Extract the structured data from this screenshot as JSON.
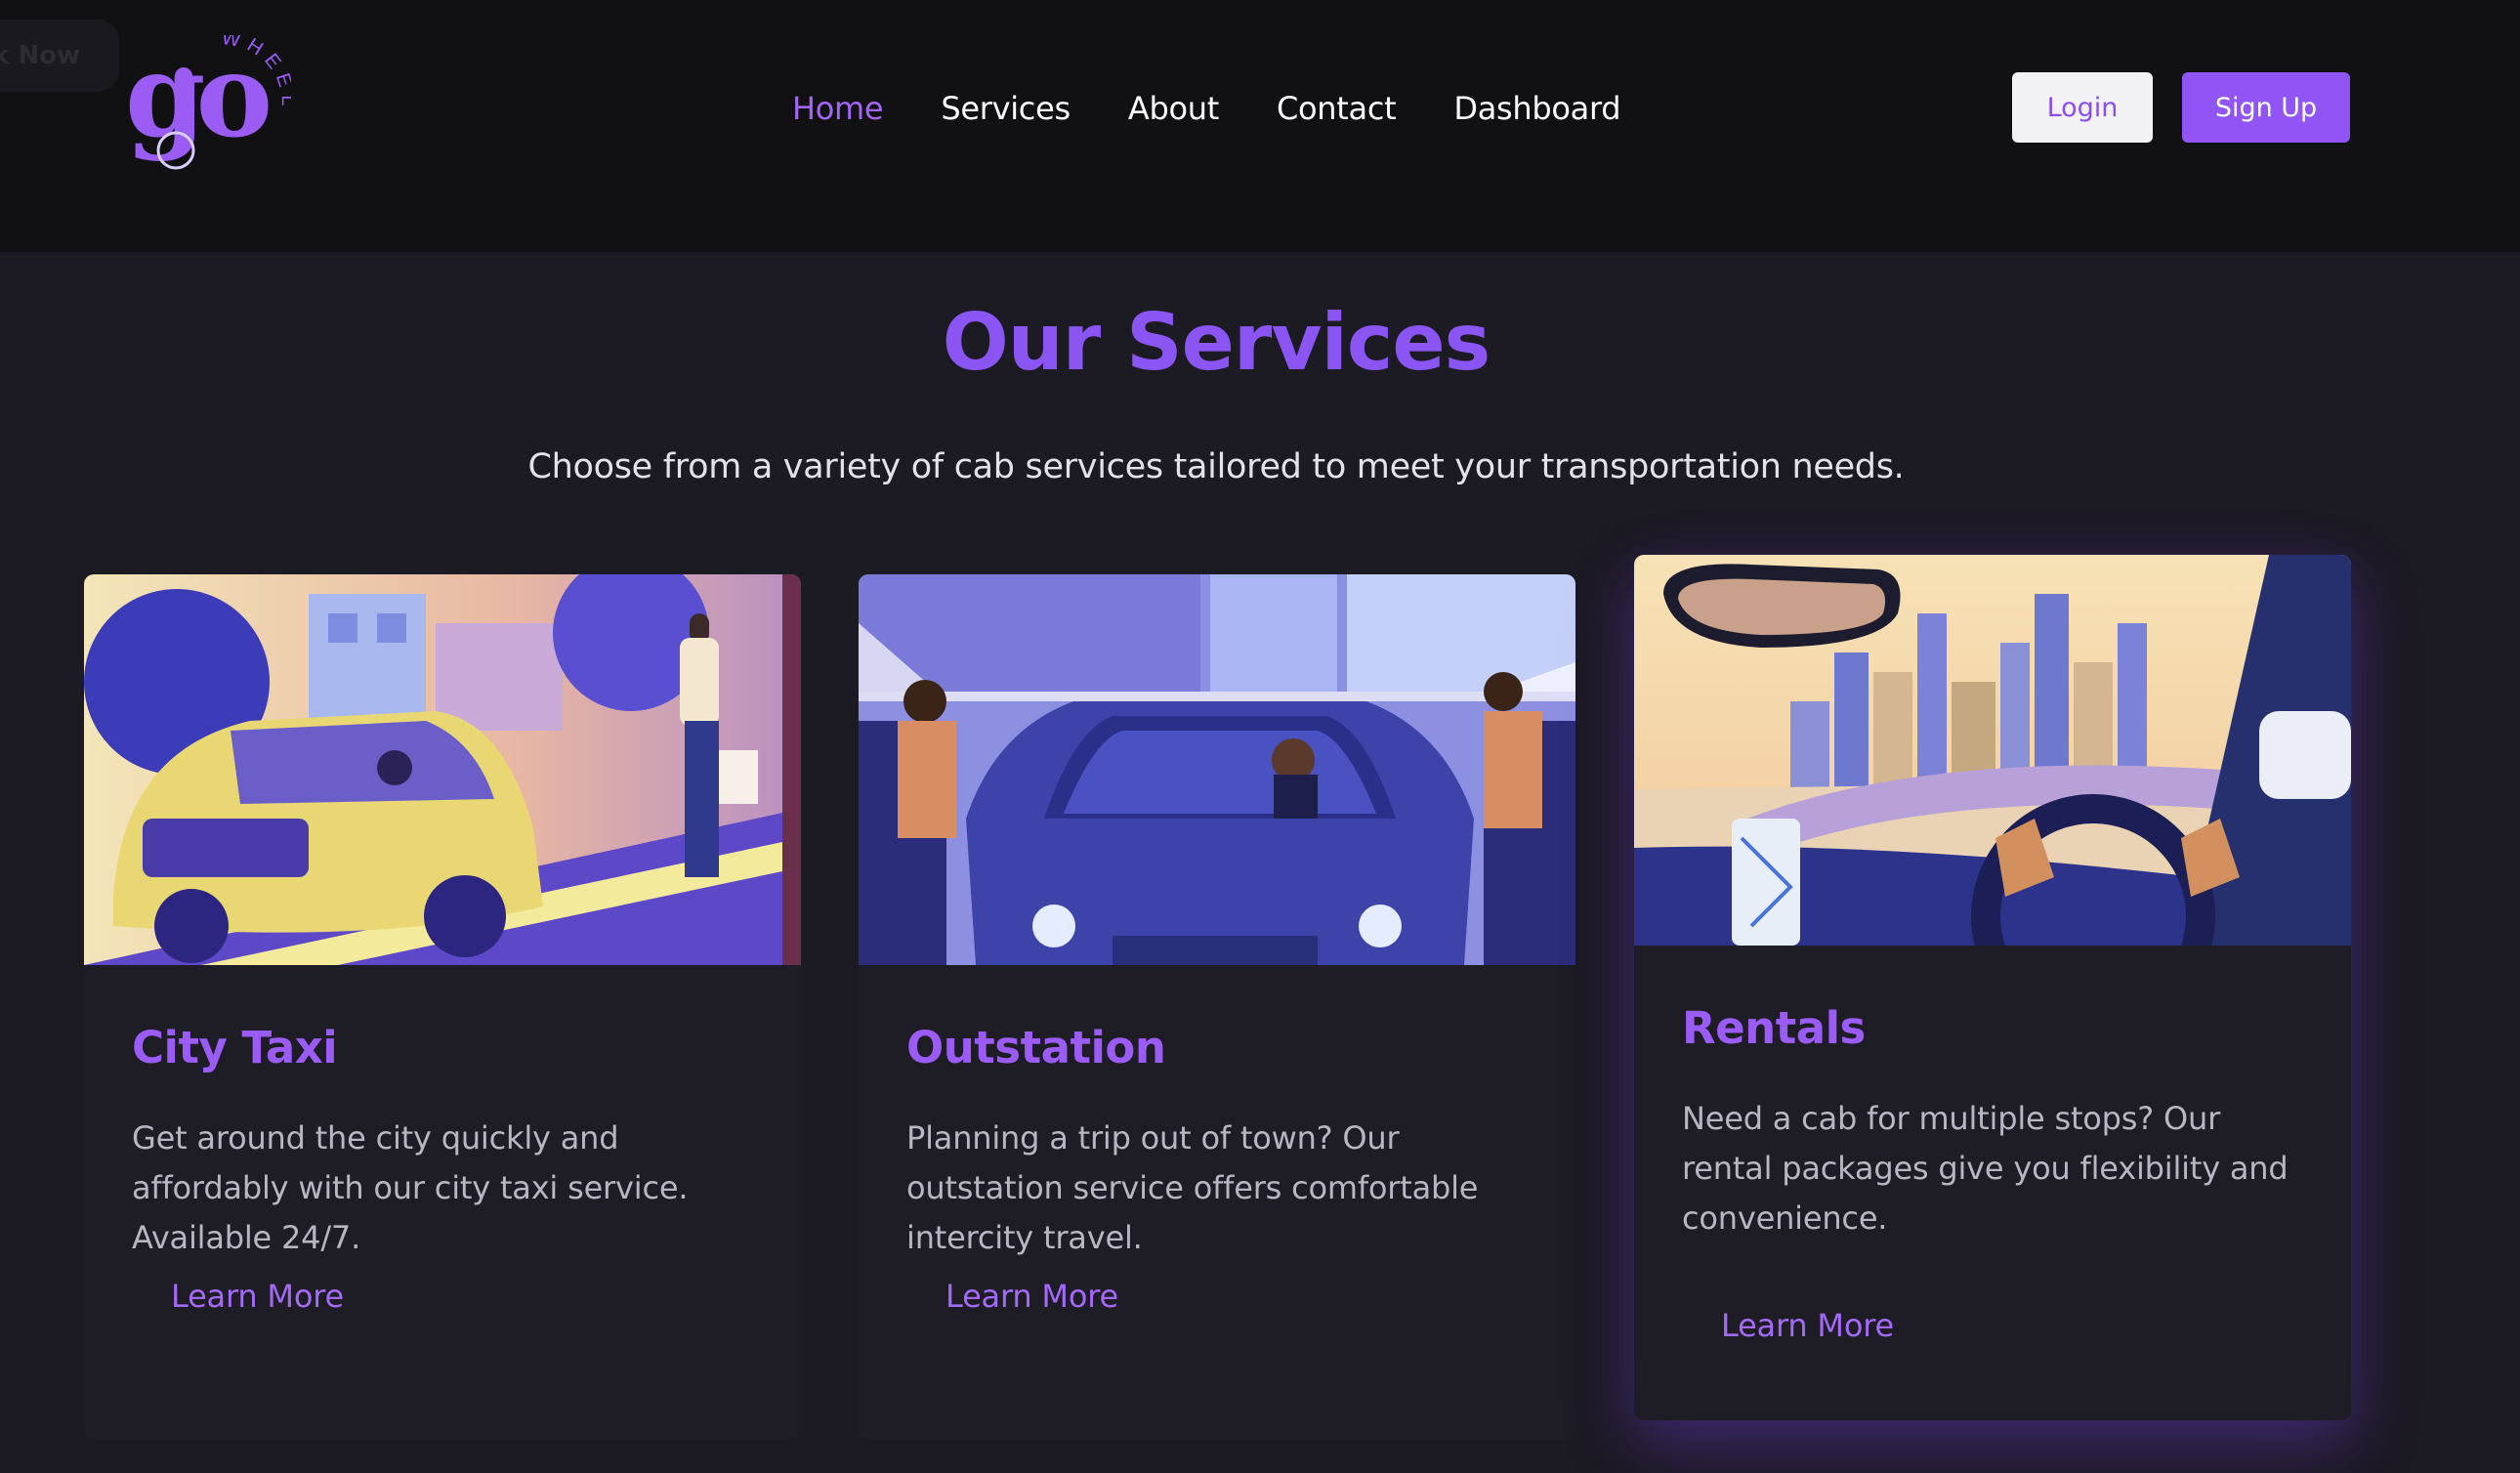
{
  "header": {
    "ghost_button_label": "k Now",
    "logo": {
      "main": "go",
      "sub": "WHEELS"
    },
    "nav": [
      {
        "label": "Home",
        "active": true
      },
      {
        "label": "Services",
        "active": false
      },
      {
        "label": "About",
        "active": false
      },
      {
        "label": "Contact",
        "active": false
      },
      {
        "label": "Dashboard",
        "active": false
      }
    ],
    "login_label": "Login",
    "signup_label": "Sign Up"
  },
  "services": {
    "title": "Our Services",
    "subtitle": "Choose from a variety of cab services tailored to meet your transportation needs.",
    "cards": [
      {
        "title": "City Taxi",
        "description": "Get around the city quickly and affordably with our city taxi service. Available 24/7.",
        "link": "Learn More"
      },
      {
        "title": "Outstation",
        "description": "Planning a trip out of town? Our outstation service offers comfortable intercity travel.",
        "link": "Learn More"
      },
      {
        "title": "Rentals",
        "description": "Need a cab for multiple stops? Our rental packages give you flexibility and convenience.",
        "link": "Learn More"
      }
    ]
  },
  "colors": {
    "accent": "#9155f5",
    "header_bg": "#111113",
    "page_bg": "#1c1a22",
    "card_bg": "#1e1c24"
  }
}
